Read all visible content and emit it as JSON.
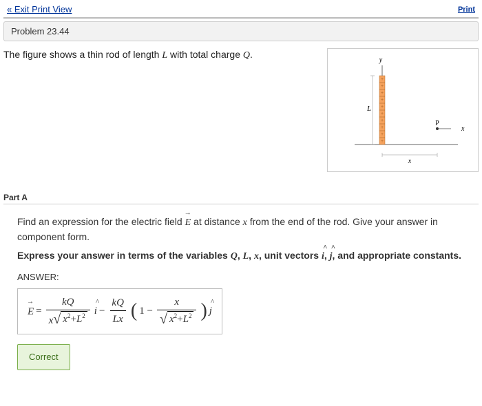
{
  "exit_link": "« Exit Print View",
  "print_link": "Print",
  "problem_title": "Problem 23.44",
  "description": "The figure shows a thin rod of length L with total charge Q.",
  "figure": {
    "ylabel": "y",
    "xlabel": "x",
    "Llabel": "L",
    "Plabel": "P",
    "xdist": "x"
  },
  "partA": {
    "heading": "Part A",
    "prompt": "Find an expression for the electric field E⃗ at distance x from the end of the rod. Give your answer in component form.",
    "instruction": "Express your answer in terms of the variables Q, L, x, unit vectors î, ĵ, and appropriate constants.",
    "answer_label": "ANSWER:",
    "correct": "Correct"
  }
}
